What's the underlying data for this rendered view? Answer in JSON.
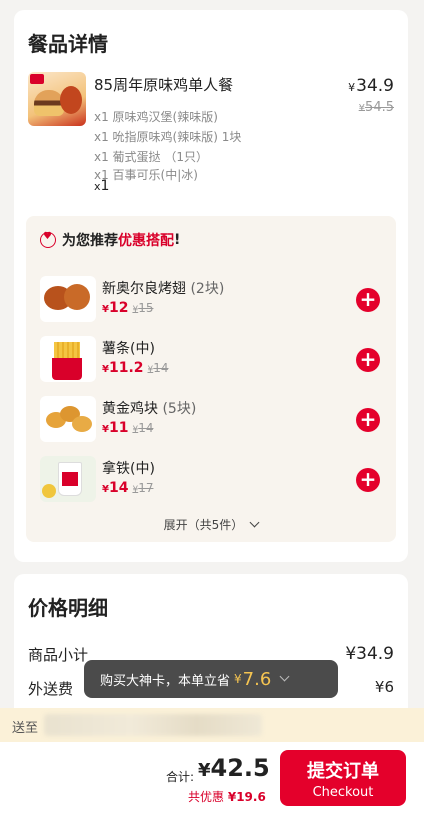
{
  "detail": {
    "title": "餐品详情",
    "item": {
      "name": "85周年原味鸡单人餐",
      "price_symbol": "¥",
      "price": "34.9",
      "orig_price": "54.5",
      "contents": [
        "x1 原味鸡汉堡(辣味版)",
        "x1 吮指原味鸡(辣味版) 1块",
        "x1 葡式蛋挞 （1只）",
        "x1 百事可乐(中|冰)"
      ],
      "qty_prefix": "x",
      "qty": "1"
    },
    "recommend": {
      "title_prefix": "为您推荐",
      "title_highlight": "优惠搭配",
      "title_suffix": "!",
      "items": [
        {
          "name": "新奥尔良烤翅",
          "paren": " (2块)",
          "price": "12",
          "orig": "15"
        },
        {
          "name": "薯条(中)",
          "paren": "",
          "price": "11.2",
          "orig": "14"
        },
        {
          "name": "黄金鸡块",
          "paren": " (5块)",
          "price": "11",
          "orig": "14"
        },
        {
          "name": "拿铁(中)",
          "paren": "",
          "price": "14",
          "orig": "17"
        }
      ],
      "add_icon": "+",
      "expand_label": "展开（共5件）"
    }
  },
  "price_detail": {
    "title": "价格明细",
    "subtotal_label": "商品小计",
    "subtotal_value": "¥34.9",
    "delivery_label": "外送费",
    "delivery_value": "¥6"
  },
  "tooltip": {
    "text": "购买大神卡，本单立省",
    "symbol": "¥",
    "amount": "7.6"
  },
  "address": {
    "label": "送至"
  },
  "footer": {
    "total_label": "合计:",
    "total_symbol": "¥",
    "total": "42.5",
    "saving_label": "共优惠",
    "saving_value": "¥19.6",
    "submit_cn": "提交订单",
    "submit_en": "Checkout"
  },
  "colors": {
    "accent": "#e4002b",
    "tooltip_amount": "#f5c451"
  }
}
